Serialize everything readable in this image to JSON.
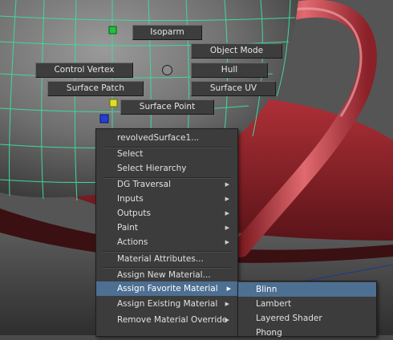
{
  "marking_menu": {
    "isoparm": "Isoparm",
    "object_mode": "Object Mode",
    "control_vertex": "Control Vertex",
    "hull": "Hull",
    "surface_patch": "Surface Patch",
    "surface_uv": "Surface UV",
    "surface_point": "Surface Point"
  },
  "context_menu": {
    "object_name": "revolvedSurface1...",
    "select": "Select",
    "select_hierarchy": "Select Hierarchy",
    "dg_traversal": "DG Traversal",
    "inputs": "Inputs",
    "outputs": "Outputs",
    "paint": "Paint",
    "actions": "Actions",
    "material_attributes": "Material Attributes...",
    "assign_new_material": "Assign New Material...",
    "assign_favorite_material": "Assign Favorite Material",
    "assign_existing_material": "Assign Existing Material",
    "remove_material_override": "Remove Material Override"
  },
  "submenu": {
    "blinn": "Blinn",
    "lambert": "Lambert",
    "layered_shader": "Layered Shader",
    "phong": "Phong"
  },
  "colors": {
    "nurbs_wire": "#3fd99b",
    "highlight": "#4d6f91",
    "handle_red": "#c0323a",
    "menu_bg": "#3c3c3c"
  }
}
